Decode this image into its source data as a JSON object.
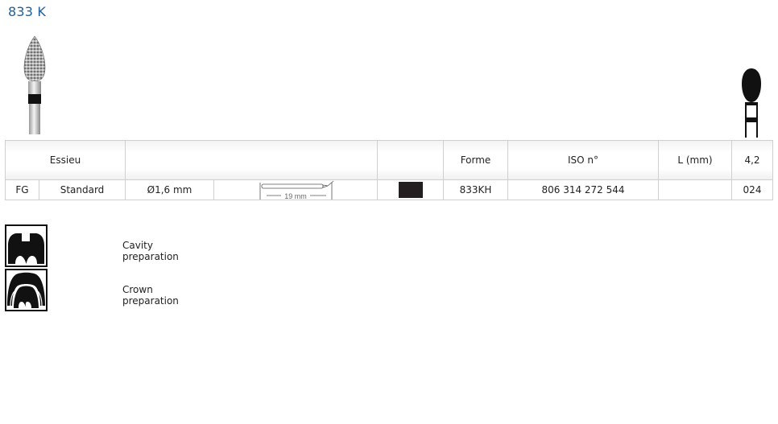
{
  "product": {
    "title": "833 K"
  },
  "table": {
    "headers": {
      "essieu": "Essieu",
      "forme": "Forme",
      "iso": "ISO n°",
      "length": "L (mm)",
      "diameter": "4,2"
    },
    "row": {
      "shank_type": "FG",
      "shank_name": "Standard",
      "shank_diameter": "Ø1,6 mm",
      "overall_length": "19 mm",
      "color_band": "#231f20",
      "forme": "833KH",
      "iso": "806 314 272 544",
      "length": "",
      "size": "024"
    }
  },
  "applications": [
    {
      "label": "Cavity preparation",
      "icon": "cavity-preparation-icon"
    },
    {
      "label": "Crown preparation",
      "icon": "crown-preparation-icon"
    }
  ]
}
